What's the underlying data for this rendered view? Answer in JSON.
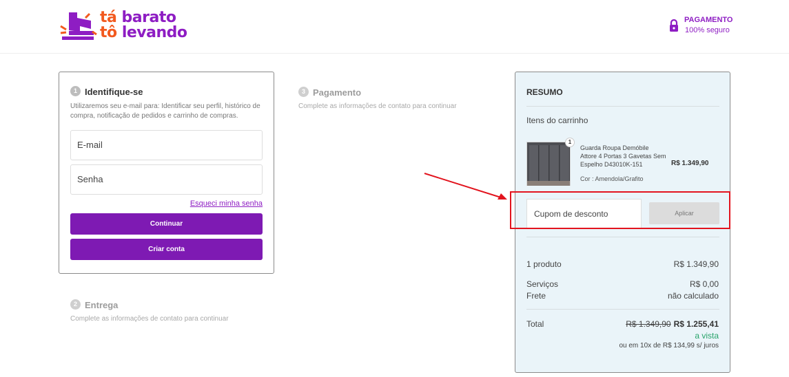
{
  "header": {
    "logo": {
      "line1_a": "tá",
      "line1_b": "barato",
      "line2_a": "tô",
      "line2_b": "levando"
    },
    "secure_title": "PAGAMENTO",
    "secure_subtitle": "100% seguro",
    "lock_icon": "lock-icon"
  },
  "identify": {
    "step_number": "1",
    "title": "Identifique-se",
    "description": "Utilizaremos seu e-mail para: Identificar seu perfil, histórico de compra, notificação de pedidos e carrinho de compras.",
    "email_placeholder": "E-mail",
    "password_placeholder": "Senha",
    "forgot_link": "Esqueci minha senha",
    "continue_button": "Continuar",
    "create_account_button": "Criar conta"
  },
  "payment_step": {
    "step_number": "3",
    "title": "Pagamento",
    "description": "Complete as informações de contato para continuar"
  },
  "delivery_step": {
    "step_number": "2",
    "title": "Entrega",
    "description": "Complete as informações de contato para continuar"
  },
  "summary": {
    "title": "RESUMO",
    "cart_label": "Itens do carrinho",
    "product": {
      "quantity": "1",
      "name": "Guarda Roupa Demóbile Attore 4 Portas 3 Gavetas Sem Espelho D43010K-151",
      "color": "Cor : Amendola/Grafito",
      "price": "R$ 1.349,90"
    },
    "coupon_placeholder": "Cupom de desconto",
    "apply_button": "Aplicar",
    "products_label": "1 produto",
    "products_value": "R$ 1.349,90",
    "services_label": "Serviços",
    "services_value": "R$ 0,00",
    "shipping_label": "Frete",
    "shipping_value": "não calculado",
    "total_label": "Total",
    "total_old": "R$ 1.349,90",
    "total_new": "R$ 1.255,41",
    "cash_label": "a vista",
    "installments": "ou em 10x de R$ 134,99 s/ juros"
  },
  "colors": {
    "brand_purple": "#8e1dc3",
    "brand_orange": "#f25a1f",
    "button_purple": "#7e1ab3",
    "summary_bg": "#eaf4f9",
    "highlight_red": "#e2131d",
    "cash_green": "#27a36a"
  }
}
